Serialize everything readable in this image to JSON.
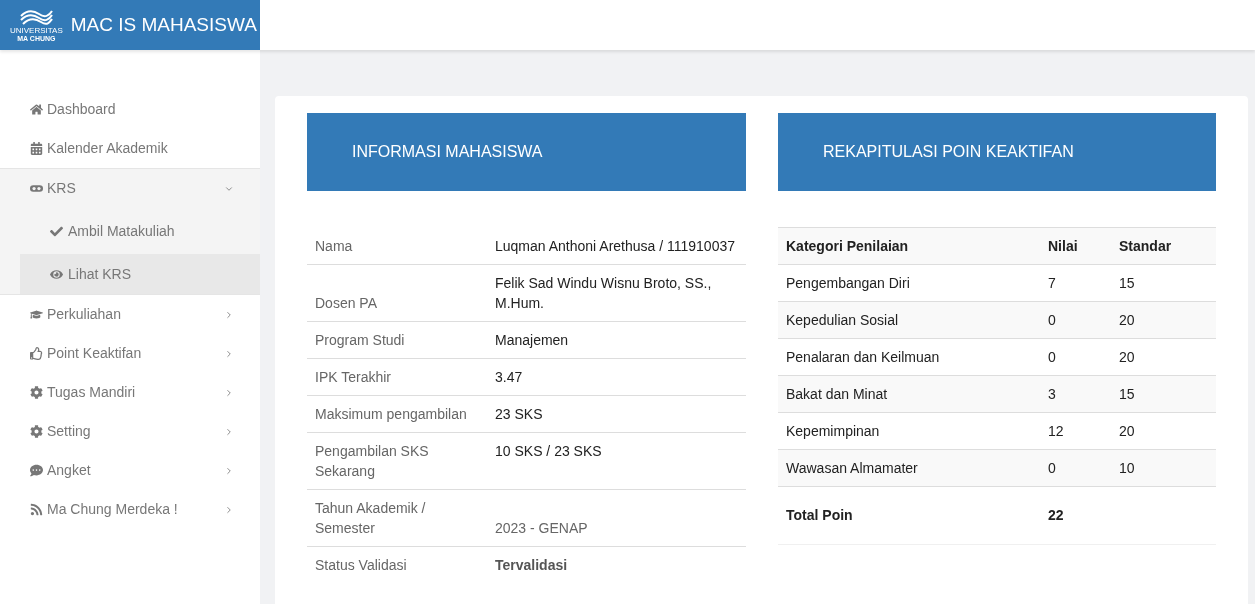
{
  "brand": {
    "title": "MAC IS MAHASISWA",
    "logo_small": "UNIVERSITAS",
    "logo_name": "MA CHUNG"
  },
  "sidebar": {
    "items": [
      {
        "label": "Dashboard",
        "kind": "link"
      },
      {
        "label": "Kalender Akademik",
        "kind": "link"
      },
      {
        "label": "KRS",
        "kind": "menu",
        "expanded": true,
        "children": [
          {
            "label": "Ambil Matakuliah",
            "selected": false
          },
          {
            "label": "Lihat KRS",
            "selected": true
          }
        ]
      },
      {
        "label": "Perkuliahan",
        "kind": "menu",
        "expanded": false
      },
      {
        "label": "Point Keaktifan",
        "kind": "menu",
        "expanded": false
      },
      {
        "label": "Tugas Mandiri",
        "kind": "menu",
        "expanded": false
      },
      {
        "label": "Setting",
        "kind": "menu",
        "expanded": false
      },
      {
        "label": "Angket",
        "kind": "menu",
        "expanded": false
      },
      {
        "label": "Ma Chung Merdeka !",
        "kind": "menu",
        "expanded": false
      }
    ]
  },
  "info_panel": {
    "title": "INFORMASI MAHASISWA",
    "rows": [
      {
        "label": "Nama",
        "value": "Luqman Anthoni Arethusa / 111910037",
        "kind": "plain"
      },
      {
        "label": "Dosen PA",
        "value": "Felik Sad Windu Wisnu Broto, SS., M.Hum.",
        "kind": "plain"
      },
      {
        "label": "Program Studi",
        "value": "Manajemen",
        "kind": "plain"
      },
      {
        "label": "IPK Terakhir",
        "value": "3.47",
        "kind": "plain"
      },
      {
        "label": "Maksimum pengambilan",
        "value": "23 SKS",
        "kind": "plain"
      },
      {
        "label": "Pengambilan SKS Sekarang",
        "value": "10 SKS / 23 SKS",
        "kind": "plain"
      },
      {
        "label": "Tahun Akademik / Semester",
        "value": "2023 - GENAP",
        "kind": "muted"
      },
      {
        "label": "Status Validasi",
        "value": "Tervalidasi",
        "kind": "bold"
      }
    ]
  },
  "points_panel": {
    "title": "REKAPITULASI POIN KEAKTIFAN",
    "columns": [
      "Kategori Penilaian",
      "Nilai",
      "Standar"
    ],
    "rows": [
      [
        "Pengembangan Diri",
        "7",
        "15"
      ],
      [
        "Kepedulian Sosial",
        "0",
        "20"
      ],
      [
        "Penalaran dan Keilmuan",
        "0",
        "20"
      ],
      [
        "Bakat dan Minat",
        "3",
        "15"
      ],
      [
        "Kepemimpinan",
        "12",
        "20"
      ],
      [
        "Wawasan Almamater",
        "0",
        "10"
      ]
    ],
    "total": {
      "label": "Total Poin",
      "value": "22"
    }
  }
}
